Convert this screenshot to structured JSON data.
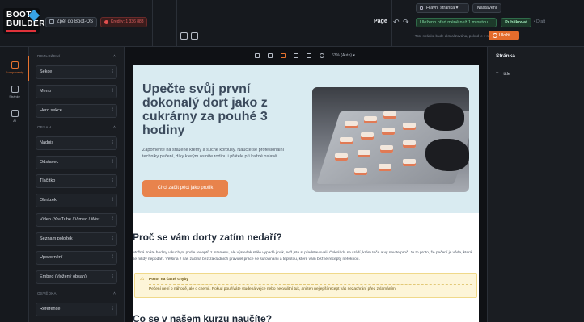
{
  "header": {
    "logo_text_1": "BOOT",
    "logo_text_2": "BUILDER",
    "back_button": "Zpět do Boot-OS",
    "credits": "Kredity: 1 336 888",
    "page_label": "Page",
    "page_select": "Hlavní stránka",
    "settings_button": "Nastavení",
    "saved_status": "Uloženo před méně než 1 minutou",
    "publish_button": "Publikovat",
    "publish_status": "• Draft",
    "note": "• Tato stránka bude aktualizována, pokud je v ní něco nového",
    "save_button": "Uložit"
  },
  "rail": {
    "items": [
      {
        "label": "Komponenty",
        "active": true
      },
      {
        "label": "Stránky"
      },
      {
        "label": "AI"
      }
    ]
  },
  "left_panel": {
    "sections": [
      {
        "title": "ROZLOŽENÍ",
        "items": [
          "Sekce",
          "Menu",
          "Hero sekce"
        ]
      },
      {
        "title": "OBSAH",
        "items": [
          "Nadpis",
          "Odstavec",
          "Tlačítko",
          "Obrázek",
          "Video (YouTube / Vimeo / Wist...",
          "Seznam položek",
          "Upozornění",
          "Embed (vložený obsah)"
        ]
      },
      {
        "title": "OSVĚDKA",
        "items": [
          "Reference"
        ]
      }
    ]
  },
  "canvas": {
    "zoom": "63% (Auto)",
    "hero_title": "Upečte svůj první dokonalý dort jako z cukrárny za pouhé 3 hodiny",
    "hero_text": "Zapomeňte na sražené krémy a suché korpusy. Naučte se profesionální techniky pečení, díky kterým oslníte rodinu i přátele při každé oslavě.",
    "hero_cta": "Chci začít péct jako profík",
    "section2_title": "Proč se vám dorty zatím nedaří?",
    "section2_text": "Možná znáte hodiny v kuchyni podle receptů z internetu, ale výsledek stále vypadá jinak, než jste si představovali. Čokoláda se sráží, krém teče a vy nevíte proč. Je to proto, že pečení je věda, která se nikdy nepodaří. Většina z nás začíná bez základních pravidel práce se surovinami a teplotou, které vám běžné recepty neřeknou.",
    "warning_title": "Pozor na časté chyby",
    "warning_text": "Pečení není o náhodě, ale o chemii. Pokud používáte studená vejce nebo nekvalitní tuk, ani ten nejlepší recept vás nezachrání před zklamáním.",
    "section3_title": "Co se v našem kurzu naučíte?"
  },
  "right_panel": {
    "title": "Stránka",
    "row_label": "T",
    "row_value": "title"
  },
  "colors": {
    "accent": "#e8732f",
    "hero_bg": "#d9ebf1",
    "cta": "#e8834c",
    "publish": "#2f6b49"
  }
}
